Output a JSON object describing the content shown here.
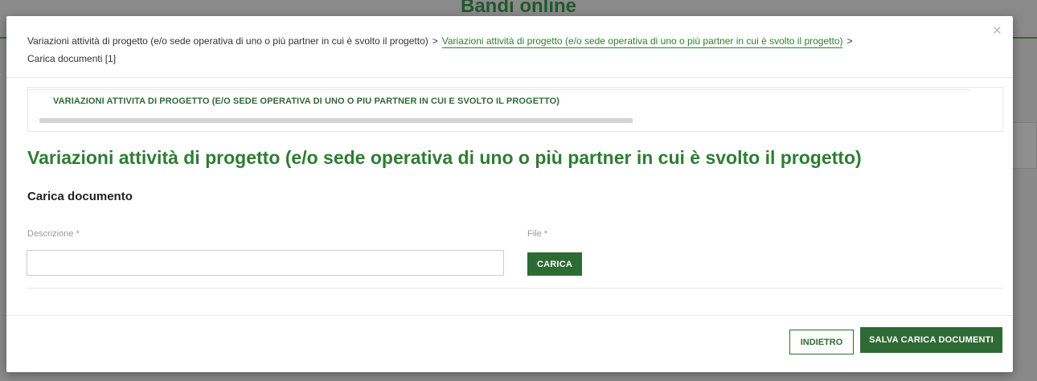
{
  "background": {
    "title": "Bandi online"
  },
  "modal": {
    "close_symbol": "×",
    "breadcrumb": {
      "items": [
        "Variazioni attività di progetto (e/o sede operativa di uno o più partner in cui è svolto il progetto)",
        "Variazioni attività di progetto (e/o sede operativa di uno o più partner in cui è svolto il progetto)",
        "Carica documenti [1]"
      ],
      "separator": ">"
    },
    "step": {
      "label": "VARIAZIONI ATTIVITA DI PROGETTO (E/O SEDE OPERATIVA DI UNO O PIU PARTNER IN CUI E SVOLTO IL PROGETTO)"
    },
    "page_title": "Variazioni attività di progetto (e/o sede operativa di uno o più partner in cui è svolto il progetto)",
    "section_title": "Carica documento",
    "form": {
      "description_label": "Descrizione *",
      "description_value": "",
      "file_label": "File *",
      "upload_button": "CARICA"
    },
    "footer": {
      "back_button": "INDIETRO",
      "save_button": "SALVA CARICA DOCUMENTI"
    }
  },
  "colors": {
    "primary_green": "#2e6b34",
    "title_green": "#2e7d32",
    "overlay": "#8a8a8a"
  }
}
